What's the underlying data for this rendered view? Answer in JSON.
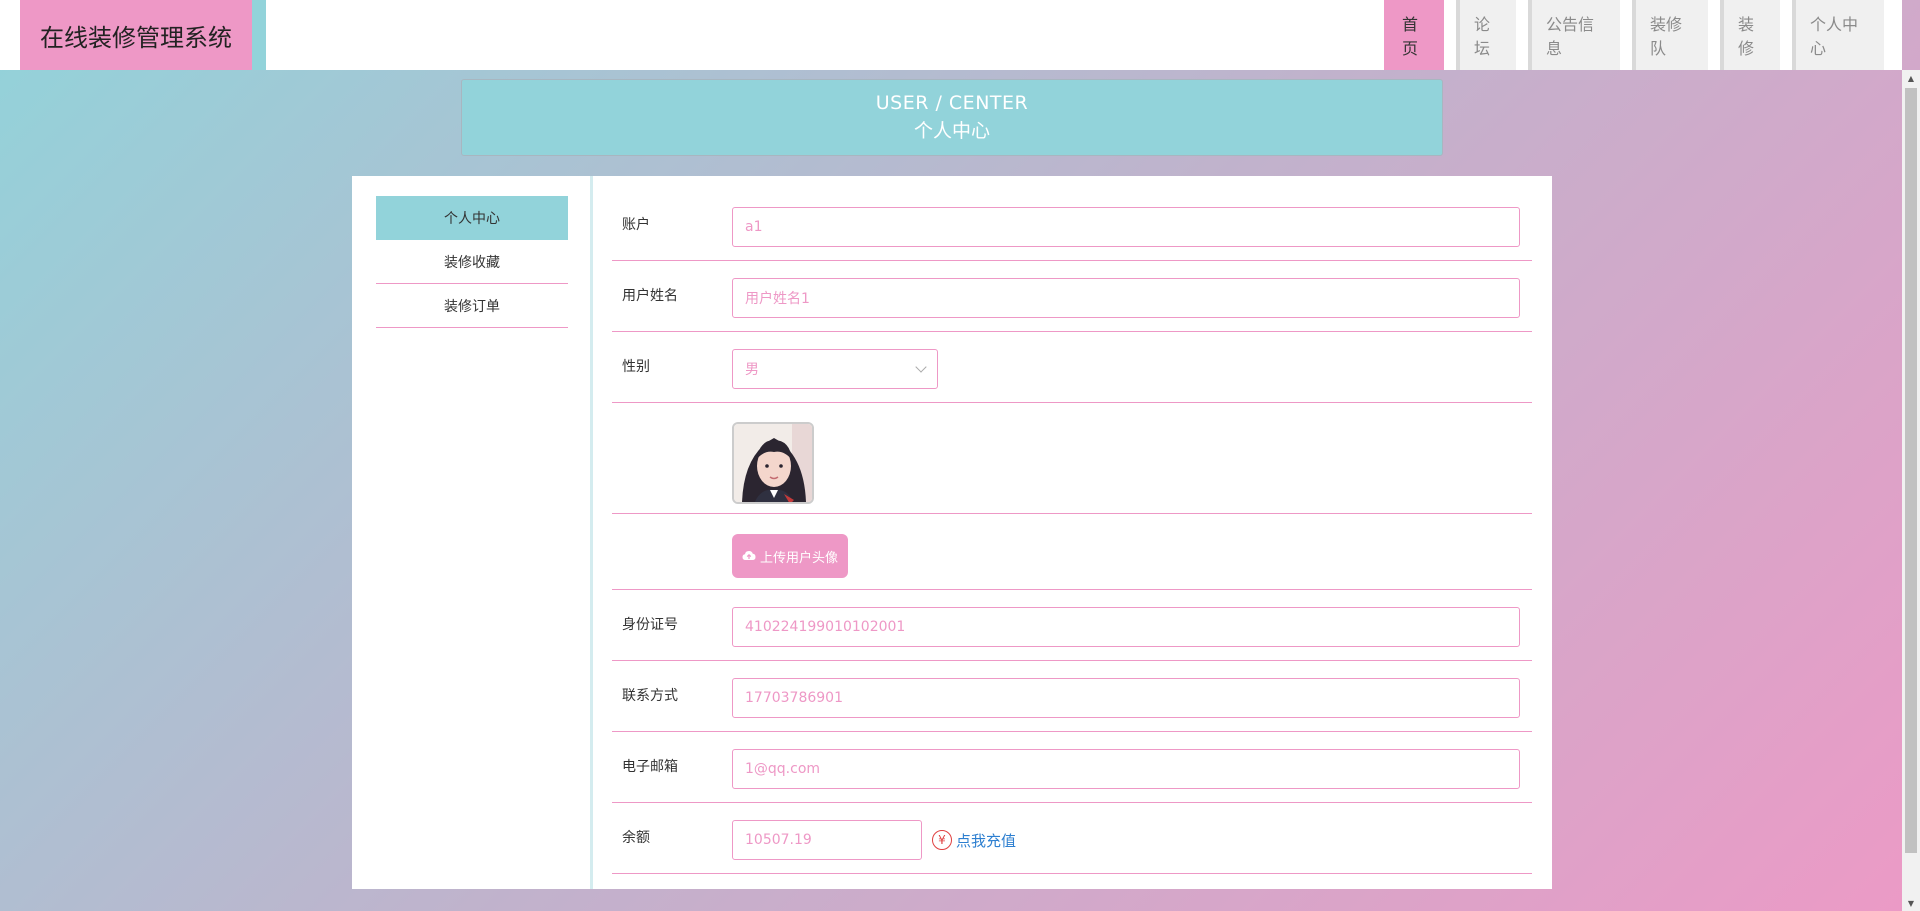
{
  "header": {
    "title": "在线装修管理系统",
    "nav": [
      {
        "label": "首页",
        "active": true
      },
      {
        "label": "论坛"
      },
      {
        "label": "公告信息"
      },
      {
        "label": "装修队"
      },
      {
        "label": "装修"
      },
      {
        "label": "个人中心"
      }
    ]
  },
  "banner": {
    "en": "USER / CENTER",
    "cn": "个人中心"
  },
  "sidebar": {
    "items": [
      {
        "label": "个人中心",
        "active": true
      },
      {
        "label": "装修收藏"
      },
      {
        "label": "装修订单"
      }
    ]
  },
  "form": {
    "account": {
      "label": "账户",
      "value": "a1"
    },
    "name": {
      "label": "用户姓名",
      "value": "用户姓名1"
    },
    "gender": {
      "label": "性别",
      "value": "男"
    },
    "upload_label": "上传用户头像",
    "id_card": {
      "label": "身份证号",
      "value": "410224199010102001"
    },
    "phone": {
      "label": "联系方式",
      "value": "17703786901"
    },
    "email": {
      "label": "电子邮箱",
      "value": "1@qq.com"
    },
    "balance": {
      "label": "余额",
      "value": "10507.19",
      "recharge_label": "点我充值",
      "yen_symbol": "¥"
    }
  },
  "colors": {
    "pink": "#ee98c6",
    "teal": "#92d3da",
    "link": "#2d7fd0"
  }
}
